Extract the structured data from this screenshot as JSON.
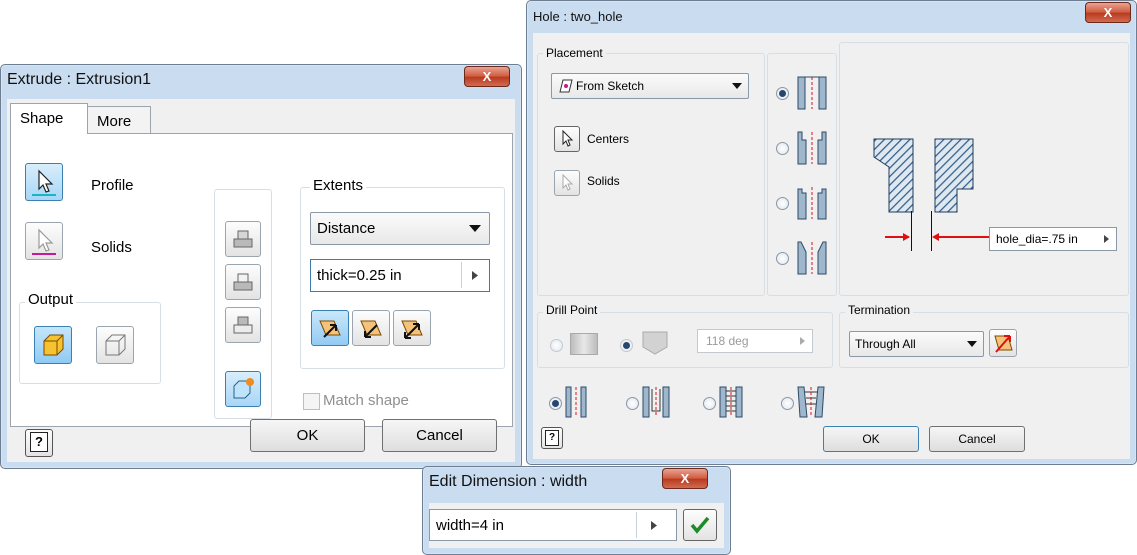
{
  "extrude": {
    "title": "Extrude : Extrusion1",
    "close_glyph": "X",
    "tabs": [
      {
        "label": "Shape"
      },
      {
        "label": "More"
      }
    ],
    "profile_label": "Profile",
    "solids_label": "Solids",
    "output_label": "Output",
    "extents_label": "Extents",
    "extents_value": "Distance",
    "distance_value": "thick=0.25 in",
    "match_shape_label": "Match shape",
    "ok_label": "OK",
    "cancel_label": "Cancel",
    "help_glyph": "?"
  },
  "hole": {
    "title": "Hole : two_hole",
    "close_glyph": "X",
    "placement_label": "Placement",
    "placement_value": "From Sketch",
    "centers_label": "Centers",
    "solids_label": "Solids",
    "diameter_value": "hole_dia=.75 in",
    "drill_point_label": "Drill Point",
    "drill_angle_value": "118 deg",
    "termination_label": "Termination",
    "termination_value": "Through All",
    "ok_label": "OK",
    "cancel_label": "Cancel",
    "help_glyph": "?"
  },
  "edit_dimension": {
    "title": "Edit Dimension : width",
    "close_glyph": "X",
    "value": "width=4 in"
  },
  "colors": {
    "titlebar": "#c9dcf0",
    "panel": "#f0f0f0",
    "selected_button": "#9fd0f5",
    "close": "#c8452a"
  }
}
